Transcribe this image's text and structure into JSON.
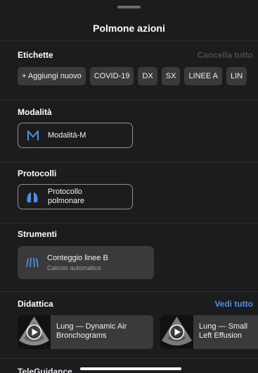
{
  "header": {
    "title": "Polmone azioni"
  },
  "labels": {
    "title": "Etichette",
    "clear_all": "Cancella tutto",
    "chips": [
      "+ Aggiungi nuovo",
      "COVID-19",
      "DX",
      "SX",
      "LINEE A",
      "LIN"
    ]
  },
  "modes": {
    "title": "Modalità",
    "m_mode": {
      "label": "Modalità-M",
      "icon": "m-mode-icon"
    }
  },
  "protocols": {
    "title": "Protocolli",
    "lung": {
      "line1": "Protocollo",
      "line2": "polmonare",
      "icon": "lung-icon"
    }
  },
  "tools": {
    "title": "Strumenti",
    "b_lines": {
      "label": "Conteggio linee B",
      "sublabel": "Calcolo automatico",
      "icon": "b-lines-icon"
    }
  },
  "didactics": {
    "title": "Didattica",
    "see_all": "Vedi tutto",
    "videos": [
      {
        "line1": "Lung — Dynamic Air",
        "line2": "Bronchograms"
      },
      {
        "line1": "Lung — Small",
        "line2": "Left Effusion"
      }
    ]
  },
  "next_section": {
    "title": "TeleGuidance"
  },
  "colors": {
    "accent": "#4a90e2",
    "background": "#1c1c1e",
    "card": "#3a3a3c"
  }
}
